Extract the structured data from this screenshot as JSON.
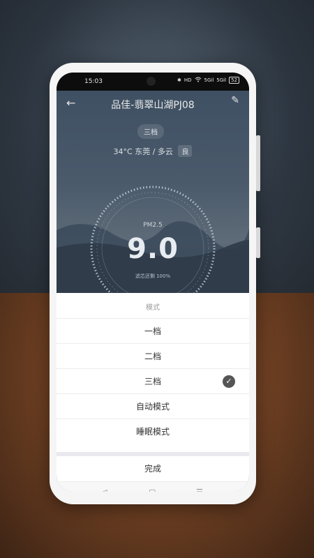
{
  "status_bar": {
    "time": "15:03",
    "bluetooth": "✱",
    "hd": "HD",
    "wifi": "wifi",
    "signal1": "5Gil",
    "signal2": "5Gil",
    "battery": "52"
  },
  "header": {
    "title": "品佳-翡翠山湖PJ08",
    "back_icon": "←",
    "edit_icon": "✎"
  },
  "device": {
    "current_mode": "三档",
    "temperature": "34°C",
    "location_weather": "东莞 / 多云",
    "air_quality": "良",
    "gauge_label": "PM2.5",
    "gauge_value": "9.0",
    "filter_status": "滤芯还剩 100%"
  },
  "mode_sheet": {
    "title": "模式",
    "options": [
      {
        "label": "一档"
      },
      {
        "label": "二档"
      },
      {
        "label": "三档"
      },
      {
        "label": "自动模式"
      },
      {
        "label": "睡眠模式"
      }
    ],
    "selected_index": 2,
    "check_icon": "✓",
    "done_label": "完成"
  },
  "nav": {
    "back": "◁",
    "home": "▢",
    "menu": "☰"
  }
}
